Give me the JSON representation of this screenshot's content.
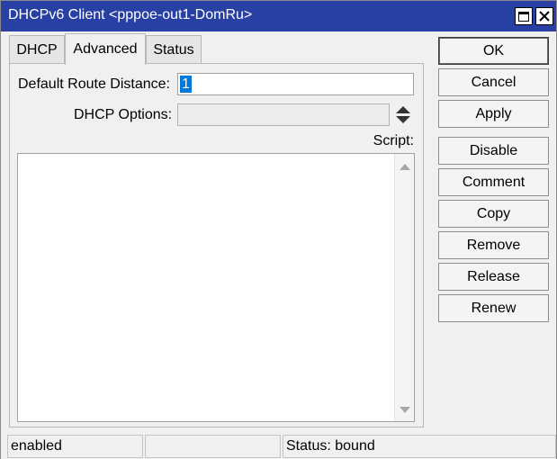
{
  "window": {
    "title": "DHCPv6 Client <pppoe-out1-DomRu>",
    "maximize_icon": "maximize-icon",
    "close_icon": "close-icon",
    "title_color": "#283fa3"
  },
  "tabs": [
    {
      "label": "DHCP",
      "active": false
    },
    {
      "label": "Advanced",
      "active": true
    },
    {
      "label": "Status",
      "active": false
    }
  ],
  "form": {
    "default_route_distance_label": "Default Route Distance:",
    "default_route_distance_value": "1",
    "dhcp_options_label": "DHCP Options:",
    "dhcp_options_value": "",
    "script_label": "Script:",
    "script_value": ""
  },
  "buttons": {
    "ok": "OK",
    "cancel": "Cancel",
    "apply": "Apply",
    "disable": "Disable",
    "comment": "Comment",
    "copy": "Copy",
    "remove": "Remove",
    "release": "Release",
    "renew": "Renew"
  },
  "statusbar": {
    "state": "enabled",
    "middle": "",
    "status": "Status: bound"
  },
  "colors": {
    "selection": "#0078d7"
  }
}
